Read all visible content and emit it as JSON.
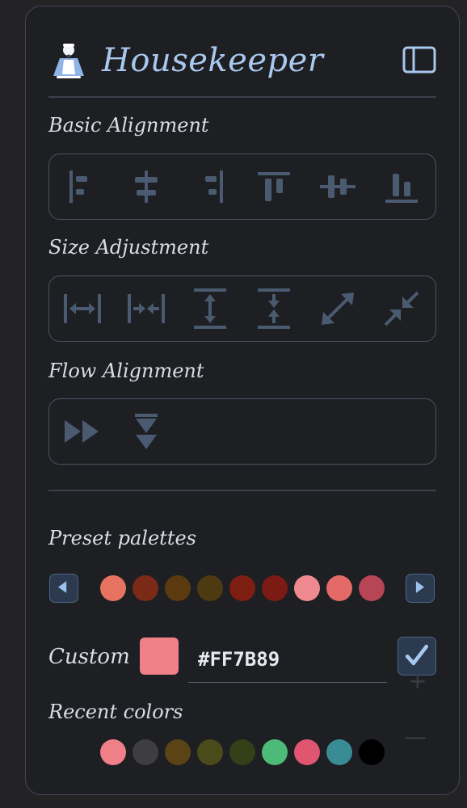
{
  "app": {
    "title": "Housekeeper",
    "mascot_icon": "maid-icon",
    "sidebar_toggle_icon": "sidebar-panel-icon"
  },
  "sections": {
    "basic_alignment": {
      "label": "Basic Alignment",
      "tools": [
        {
          "name": "align-left-icon"
        },
        {
          "name": "align-center-horizontal-icon"
        },
        {
          "name": "align-right-icon"
        },
        {
          "name": "align-top-icon"
        },
        {
          "name": "align-center-vertical-icon"
        },
        {
          "name": "align-bottom-icon"
        }
      ]
    },
    "size_adjustment": {
      "label": "Size Adjustment",
      "tools": [
        {
          "name": "stretch-width-icon"
        },
        {
          "name": "shrink-width-icon"
        },
        {
          "name": "stretch-height-icon"
        },
        {
          "name": "shrink-height-icon"
        },
        {
          "name": "expand-diagonal-icon"
        },
        {
          "name": "shrink-diagonal-icon"
        }
      ]
    },
    "flow_alignment": {
      "label": "Flow Alignment",
      "tools": [
        {
          "name": "flow-horizontal-icon"
        },
        {
          "name": "flow-vertical-icon"
        }
      ]
    }
  },
  "palettes": {
    "label": "Preset palettes",
    "prev_icon": "triangle-left-icon",
    "next_icon": "triangle-right-icon",
    "colors": [
      "#E6735F",
      "#7A2A17",
      "#5C3A10",
      "#4D3A10",
      "#7E1D12",
      "#7B1B14",
      "#EE8A8F",
      "#E36A66",
      "#B84555"
    ]
  },
  "custom": {
    "label": "Custom",
    "value": "#FF7B89",
    "preview_color": "#F08088",
    "apply_icon": "checkmark-icon"
  },
  "recent": {
    "label": "Recent colors",
    "colors": [
      "#F08088",
      "#3E3E42",
      "#5A4415",
      "#4A4A1A",
      "#334018",
      "#4DBA78",
      "#E05570",
      "#3A8C94",
      "#000000"
    ]
  },
  "colors": {
    "accent": "#A9C8EE",
    "icon": "#4A5A70",
    "panel_bg": "#1E1F23",
    "border": "#4A5262"
  }
}
